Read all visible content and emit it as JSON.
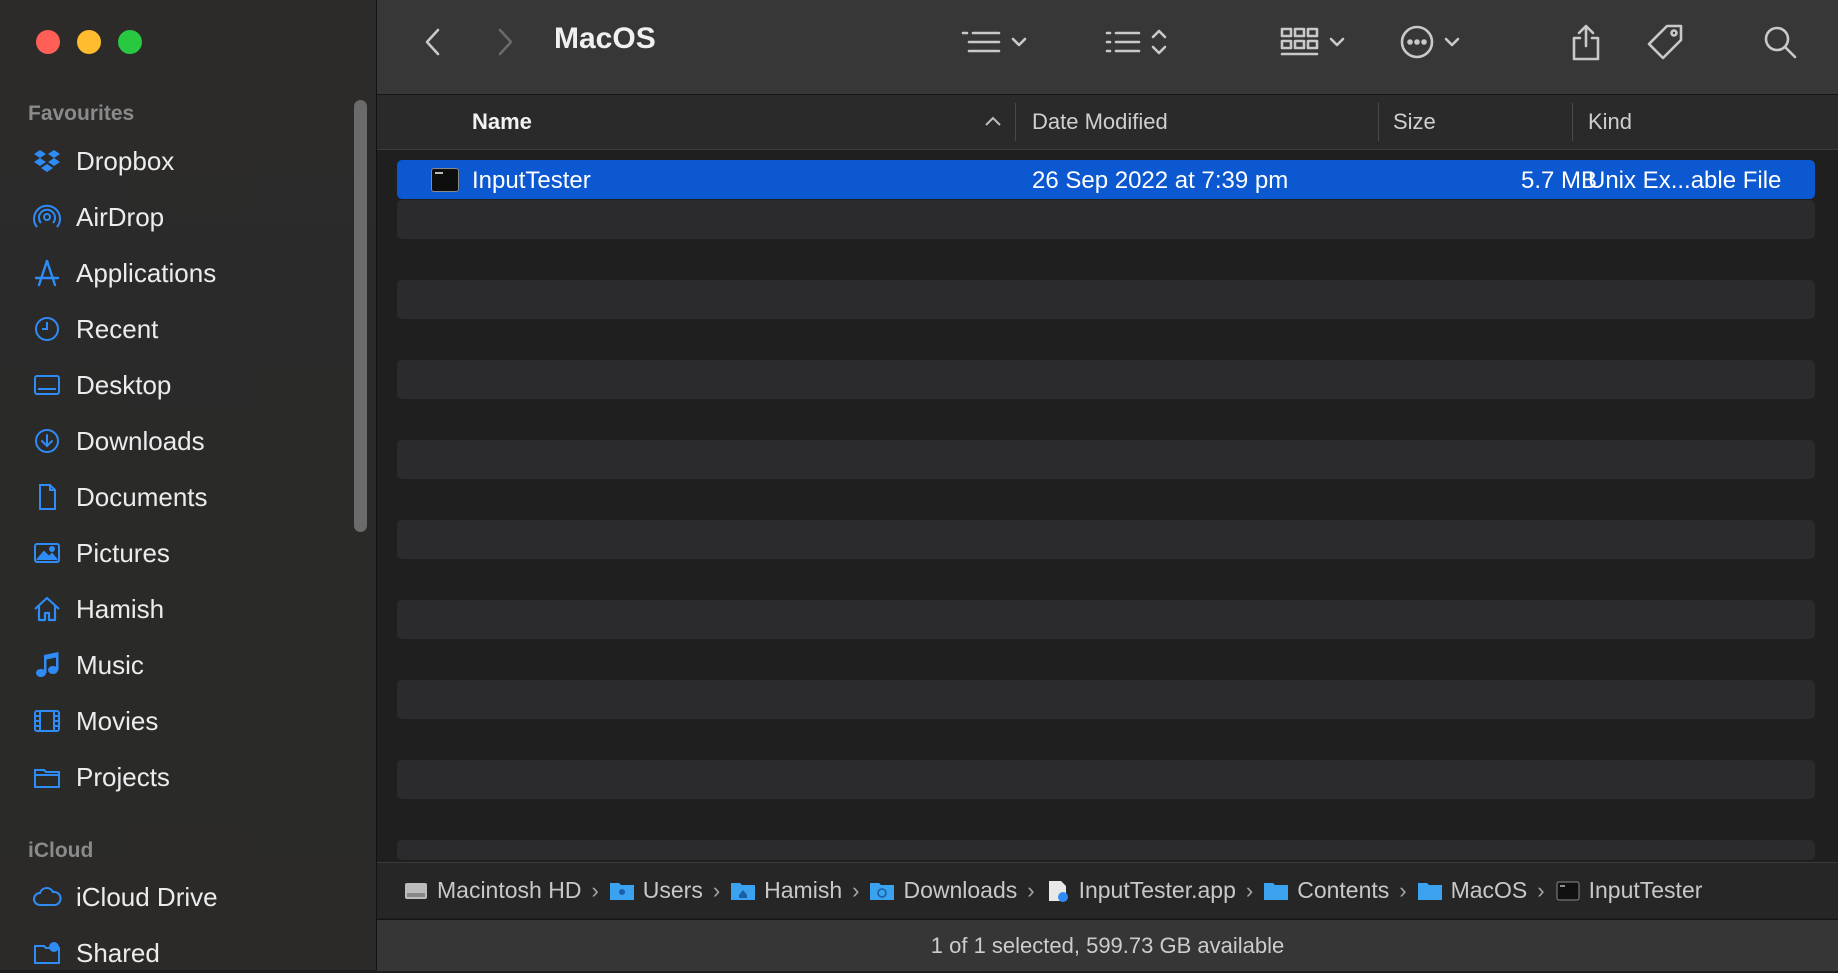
{
  "window": {
    "title": "MacOS"
  },
  "sidebar": {
    "favourites_label": "Favourites",
    "icloud_label": "iCloud",
    "items": [
      {
        "label": "Dropbox",
        "icon": "dropbox-icon"
      },
      {
        "label": "AirDrop",
        "icon": "airdrop-icon"
      },
      {
        "label": "Applications",
        "icon": "applications-icon"
      },
      {
        "label": "Recent",
        "icon": "clock-icon"
      },
      {
        "label": "Desktop",
        "icon": "desktop-icon"
      },
      {
        "label": "Downloads",
        "icon": "download-icon"
      },
      {
        "label": "Documents",
        "icon": "document-icon"
      },
      {
        "label": "Pictures",
        "icon": "photo-icon"
      },
      {
        "label": "Hamish",
        "icon": "home-icon"
      },
      {
        "label": "Music",
        "icon": "music-note-icon"
      },
      {
        "label": "Movies",
        "icon": "film-icon"
      },
      {
        "label": "Projects",
        "icon": "folder-icon"
      }
    ],
    "icloud_items": [
      {
        "label": "iCloud Drive",
        "icon": "cloud-icon"
      },
      {
        "label": "Shared",
        "icon": "shared-folder-icon"
      }
    ]
  },
  "columns": {
    "name": "Name",
    "date": "Date Modified",
    "size": "Size",
    "kind": "Kind"
  },
  "files": [
    {
      "name": "InputTester",
      "date": "26 Sep 2022 at 7:39 pm",
      "size": "5.7 MB",
      "kind": "Unix Ex...able File"
    }
  ],
  "pathbar": [
    {
      "label": "Macintosh HD",
      "icon": "hard-drive-icon"
    },
    {
      "label": "Users",
      "icon": "users-folder-icon"
    },
    {
      "label": "Hamish",
      "icon": "home-folder-icon"
    },
    {
      "label": "Downloads",
      "icon": "downloads-folder-icon"
    },
    {
      "label": "InputTester.app",
      "icon": "app-icon"
    },
    {
      "label": "Contents",
      "icon": "folder-icon"
    },
    {
      "label": "MacOS",
      "icon": "folder-icon"
    },
    {
      "label": "InputTester",
      "icon": "executable-icon"
    }
  ],
  "status": "1 of 1 selected, 599.73 GB available",
  "colors": {
    "accent": "#0b58d0",
    "sidebar_icon": "#2f8cf7"
  }
}
